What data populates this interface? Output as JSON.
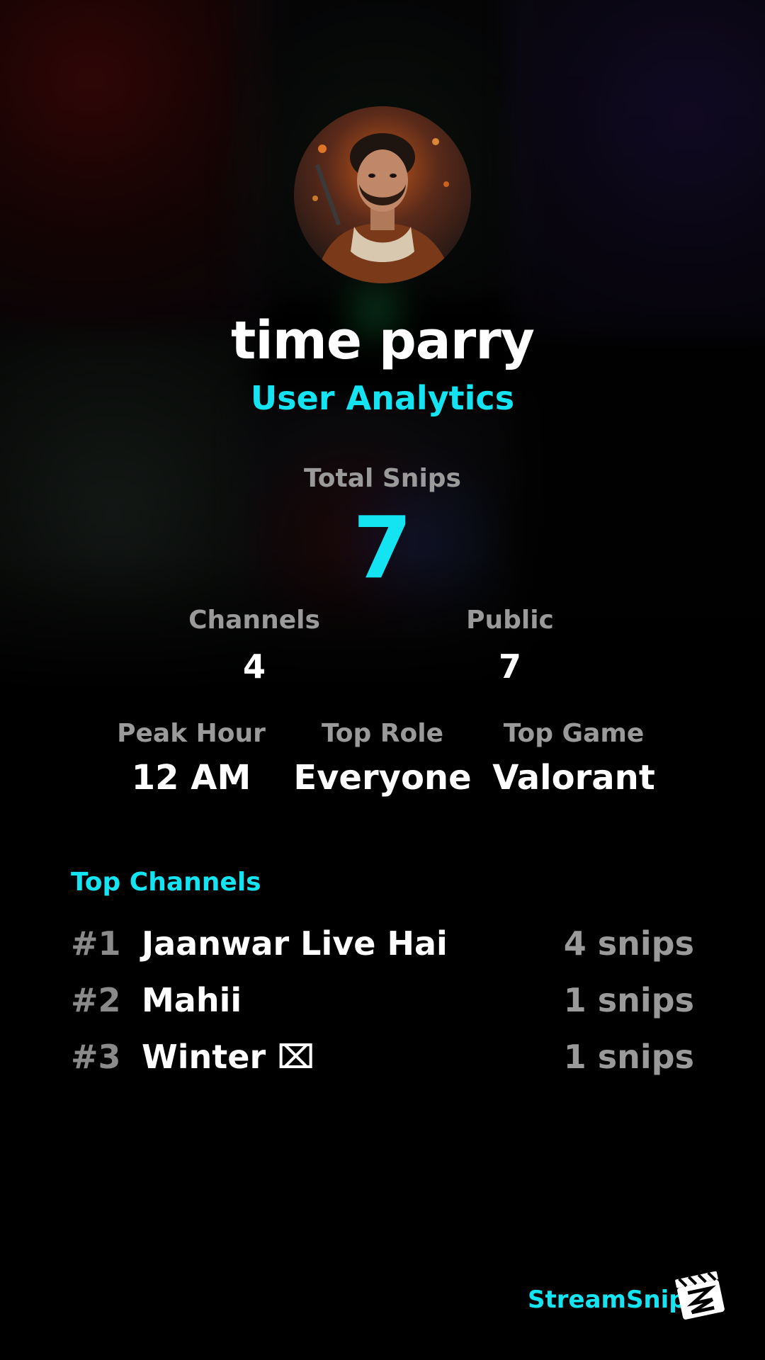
{
  "profile": {
    "username": "time parry",
    "subtitle": "User Analytics"
  },
  "total": {
    "label": "Total Snips",
    "value": "7"
  },
  "stats_row1": {
    "channels_label": "Channels",
    "channels_value": "4",
    "public_label": "Public",
    "public_value": "7"
  },
  "stats_row2": {
    "peak_label": "Peak Hour",
    "peak_value": "12 AM",
    "role_label": "Top Role",
    "role_value": "Everyone",
    "game_label": "Top Game",
    "game_value": "Valorant"
  },
  "top_channels": {
    "title": "Top Channels",
    "items": [
      {
        "rank": "#1",
        "name": "Jaanwar Live Hai",
        "count": "4 snips"
      },
      {
        "rank": "#2",
        "name": "Mahii",
        "count": "1 snips"
      },
      {
        "rank": "#3",
        "name": "Winter ⌧",
        "count": "1 snips"
      }
    ]
  },
  "brand": {
    "name": "StreamSnip",
    "logo_icon": "clapperboard-logo-icon"
  },
  "colors": {
    "accent": "#14e4f2",
    "muted": "#9a9a9a",
    "background": "#000000"
  }
}
